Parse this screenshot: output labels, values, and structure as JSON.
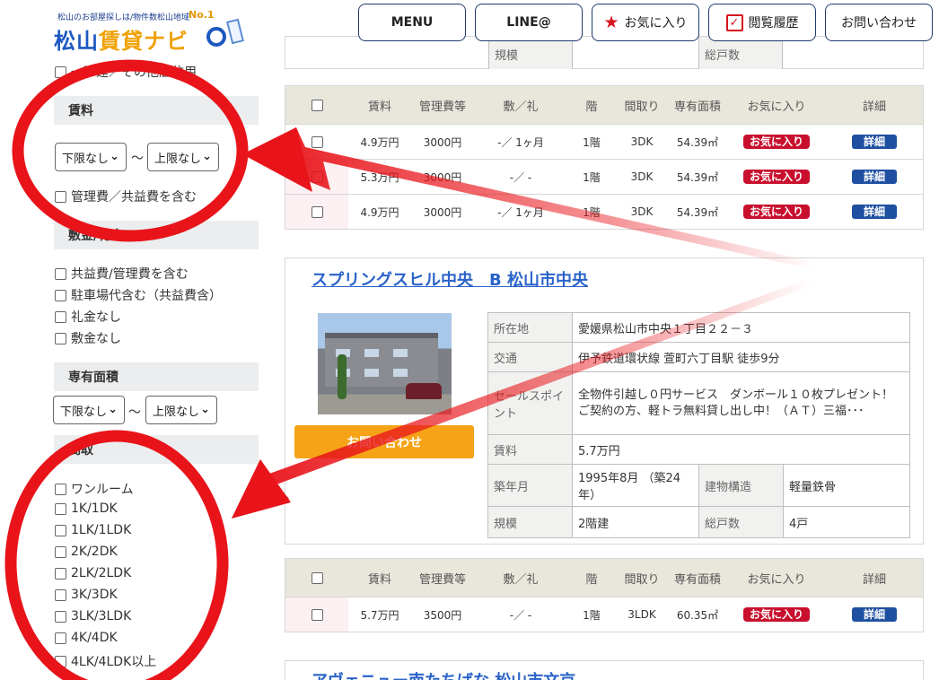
{
  "header": {
    "logo_tagline": "松山のお部屋探しは/物件数松山地域",
    "logo_no1": "No.1",
    "logo_name_blue": "松山",
    "logo_name_orange": "賃貸ナビ",
    "nav": {
      "menu": "MENU",
      "line": "LINE@",
      "favorites": "お気に入り",
      "history": "閲覧履歴",
      "contact": "お問い合わせ"
    }
  },
  "sidebar": {
    "top_item": "一戸建／その他居住用",
    "rent": {
      "heading": "賃料",
      "min": "下限なし",
      "max": "上限なし",
      "tilde": "〜",
      "option": "管理費／共益費を含む"
    },
    "deposit": {
      "heading": "敷金/礼金",
      "options": [
        "共益費/管理費を含む",
        "駐車場代含む（共益費含）",
        "礼金なし",
        "敷金なし"
      ]
    },
    "area": {
      "heading": "専有面積",
      "min": "下限なし",
      "max": "上限なし",
      "tilde": "〜"
    },
    "layout": {
      "heading": "間取",
      "options": [
        "ワンルーム",
        "1K/1DK",
        "1LK/1LDK",
        "2K/2DK",
        "2LK/2LDK",
        "3K/3DK",
        "3LK/3LDK",
        "4K/4DK",
        "4LK/4LDK以上"
      ]
    }
  },
  "table_headers": [
    "賃料",
    "管理費等",
    "敷／礼",
    "階",
    "間取り",
    "専有面積",
    "お気に入り",
    "詳細"
  ],
  "listing1": {
    "top_labels": [
      "規模",
      "総戸数"
    ],
    "rows": [
      {
        "rent": "4.9万円",
        "fee": "3000円",
        "deposit": "-／ 1ヶ月",
        "floor": "1階",
        "layout": "3DK",
        "area": "54.39㎡",
        "fav": "お気に入り",
        "detail": "詳細"
      },
      {
        "rent": "5.3万円",
        "fee": "3000円",
        "deposit": "-／ -",
        "floor": "1階",
        "layout": "3DK",
        "area": "54.39㎡",
        "fav": "お気に入り",
        "detail": "詳細"
      },
      {
        "rent": "4.9万円",
        "fee": "3000円",
        "deposit": "-／ 1ヶ月",
        "floor": "1階",
        "layout": "3DK",
        "area": "54.39㎡",
        "fav": "お気に入り",
        "detail": "詳細"
      }
    ]
  },
  "listing2": {
    "title": "スプリングスヒル中央　B 松山市中央",
    "inquiry_button": "お問い合わせ",
    "info": {
      "address_label": "所在地",
      "address": "愛媛県松山市中央１丁目２２－３",
      "traffic_label": "交通",
      "traffic": "伊予鉄道環状線 萱町六丁目駅 徒歩9分",
      "sales_label": "セールスポイント",
      "sales": "全物件引越し０円サービス　ダンボール１０枚プレゼント！ご契約の方、軽トラ無料貸し出し中！（ＡＴ）三福･･･",
      "rent_label": "賃料",
      "rent": "5.7万円",
      "built_label": "築年月",
      "built": "1995年8月 （築24年）",
      "structure_label": "建物構造",
      "structure": "軽量鉄骨",
      "scale_label": "規模",
      "scale": "2階建",
      "units_label": "総戸数",
      "units": "4戸"
    },
    "rows": [
      {
        "rent": "5.7万円",
        "fee": "3500円",
        "deposit": "-／ -",
        "floor": "1階",
        "layout": "3LDK",
        "area": "60.35㎡",
        "fav": "お気に入り",
        "detail": "詳細"
      }
    ]
  },
  "listing3": {
    "title": "アヴェニュー南たちばな 松山市文京"
  },
  "colors": {
    "accent_red": "#e8141a",
    "link_blue": "#2a63c9",
    "fav_red": "#c8102e",
    "detail_blue": "#1e4fa0",
    "orange": "#f6a318"
  }
}
